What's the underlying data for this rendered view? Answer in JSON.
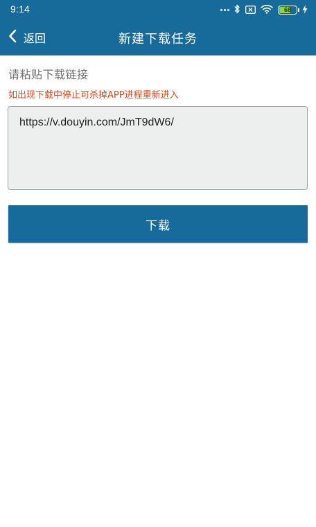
{
  "status_bar": {
    "time": "9:14",
    "battery_level": "68",
    "icons": [
      "more-dots-icon",
      "bluetooth-icon",
      "sim-off-icon",
      "wifi-icon",
      "battery-icon",
      "charging-bolt-icon"
    ]
  },
  "nav": {
    "back_label": "返回",
    "title": "新建下载任务"
  },
  "form": {
    "paste_label": "请粘贴下载链接",
    "warning": "如出现下载中停止可杀掉APP进程重新进入",
    "url_value": "https://v.douyin.com/JmT9dW6/",
    "download_button": "下载"
  },
  "colors": {
    "header": "#166b9a",
    "button": "#166b9a",
    "warning": "#e0491c",
    "input_bg": "#edefee",
    "battery_fill": "#8bd34a"
  }
}
